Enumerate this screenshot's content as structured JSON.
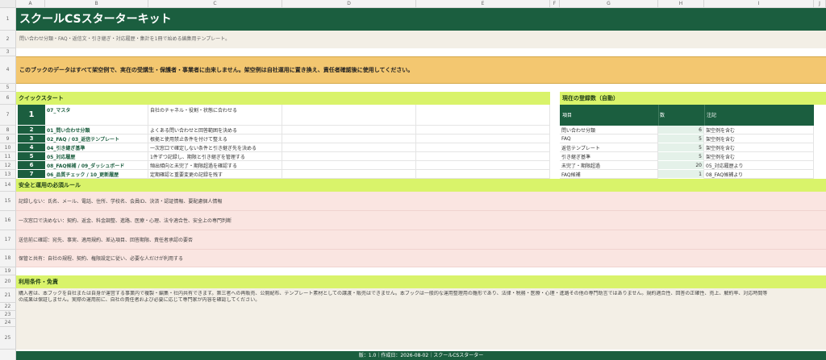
{
  "column_headers": [
    "A",
    "B",
    "C",
    "D",
    "E",
    "F",
    "G",
    "H",
    "I",
    "J"
  ],
  "row_numbers": [
    "1",
    "2",
    "3",
    "4",
    "5",
    "6",
    "7",
    "8",
    "9",
    "10",
    "11",
    "12",
    "13",
    "14",
    "15",
    "16",
    "17",
    "18",
    "19",
    "20",
    "21",
    "22",
    "23",
    "24",
    "25"
  ],
  "title": "スクールCSスターターキット",
  "subtitle": "問い合わせ分類・FAQ・返信文・引き継ぎ・対応履歴・集計を1冊で始める編集用テンプレート。",
  "notice": "このブックのデータはすべて架空例で、実在の受講生・保護者・事業者に由来しません。架空例は自社運用に置き換え、責任者確認後に使用してください。",
  "quickstart": {
    "header": "クイックスタート",
    "items": [
      {
        "num": "1",
        "name": "07_マスタ",
        "desc": "自社のチャネル・役割・状態に合わせる"
      },
      {
        "num": "2",
        "name": "01_問い合わせ分類",
        "desc": "よくある問い合わせと回答範囲を決める"
      },
      {
        "num": "3",
        "name": "02_FAQ / 03_返信テンプレート",
        "desc": "根拠と使用禁止条件を付けて整える"
      },
      {
        "num": "4",
        "name": "04_引き継ぎ基準",
        "desc": "一次窓口で確定しない条件と引き継ぎ先を決める"
      },
      {
        "num": "5",
        "name": "05_対応履歴",
        "desc": "1件ずつ記録し、期限と引き継ぎを管理する"
      },
      {
        "num": "6",
        "name": "08_FAQ候補 / 09_ダッシュボード",
        "desc": "頻出傾向と未完了・期限超過を確認する"
      },
      {
        "num": "7",
        "name": "06_品質チェック / 10_更新履歴",
        "desc": "定期確認と重要変更の記録を残す"
      }
    ]
  },
  "registry": {
    "header": "現在の登録数（自動）",
    "col_item": "項目",
    "col_count": "数",
    "col_note": "注記",
    "rows": [
      {
        "item": "問い合わせ分類",
        "count": "6",
        "note": "架空例を含む"
      },
      {
        "item": "FAQ",
        "count": "5",
        "note": "架空例を含む"
      },
      {
        "item": "返信テンプレート",
        "count": "5",
        "note": "架空例を含む"
      },
      {
        "item": "引き継ぎ基準",
        "count": "5",
        "note": "架空例を含む"
      },
      {
        "item": "未完了・期限超過",
        "count": "20",
        "note": "05_対応履歴より"
      },
      {
        "item": "FAQ候補",
        "count": "1",
        "note": "08_FAQ候補より"
      }
    ]
  },
  "safety": {
    "header": "安全と運用の必須ルール",
    "rules": [
      "記録しない：氏名、メール、電話、住所、学校名、会員ID、決済・認証情報、要配慮個人情報",
      "一次窓口で決めない：契約、返金、料金調整、進路、医療・心理、法令適合性、安全上の専門判断",
      "送信前に確認：宛先、事実、適用規約、差込項目、回答期限、責任者承認の要否",
      "保管と共有：自社の規程、契約、権限設定に従い、必要な人だけが利用する"
    ]
  },
  "terms": {
    "header": "利用条件・免責",
    "line1": "購入者は、本ブックを自社または自身が運営する事業内で複製・編集・社内共有できます。第三者への再販売、公開配布、テンプレート素材としての譲渡・販売はできません。本ブックは一般的な運用整理用の雛形であり、法律・税務・医療・心理・進路その他の専門助言ではありません。規約適合性、回答の正確性、売上、解約率、対応時間等",
    "line2": "の成果は保証しません。実際の運用前に、自社の責任者および必要に応じて専門家が内容を確認してください。"
  },
  "footer": "版：1.0｜作成日：2026-08-02｜スクールCSスターター",
  "colors": {
    "title_bg": "#1b5e3f",
    "accent_green": "#d9f36a",
    "notice_bg": "#f3c770",
    "rule_bg": "#fae5e1",
    "terms_bg": "#f3efe6"
  }
}
